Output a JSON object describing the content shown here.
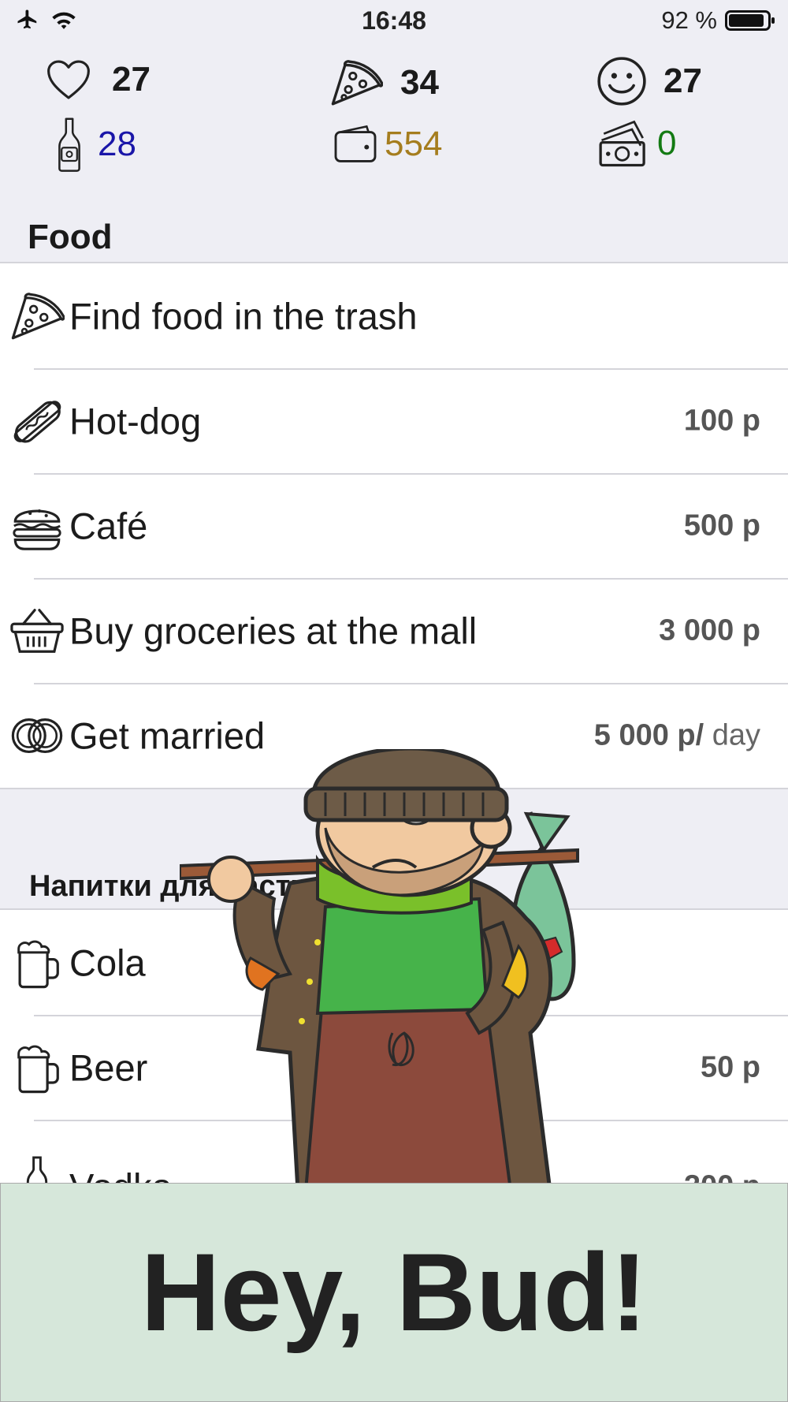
{
  "status_bar": {
    "time": "16:48",
    "battery": "92 %",
    "battery_level": 0.92
  },
  "stats": {
    "health": {
      "icon": "heart-icon",
      "value": "27",
      "color": "#1a1a1a"
    },
    "food": {
      "icon": "pizza-icon",
      "value": "34",
      "color": "#1a1a1a"
    },
    "mood": {
      "icon": "smiley-icon",
      "value": "27",
      "color": "#1a1a1a"
    },
    "alcohol": {
      "icon": "bottle-icon",
      "value": "28",
      "color": "#1a16a8"
    },
    "money": {
      "icon": "wallet-icon",
      "value": "554",
      "color": "#a57d1e"
    },
    "dollars": {
      "icon": "cash-icon",
      "value": "0",
      "color": "#137a13"
    }
  },
  "food_section": {
    "title": "Food",
    "items": [
      {
        "icon": "pizza-slice-icon",
        "label": "Find food in the trash",
        "price": "",
        "per": ""
      },
      {
        "icon": "hotdog-icon",
        "label": "Hot-dog",
        "price": "100 р",
        "per": ""
      },
      {
        "icon": "burger-icon",
        "label": "Café",
        "price": "500 р",
        "per": ""
      },
      {
        "icon": "basket-icon",
        "label": "Buy groceries at the mall",
        "price": "3 000 р",
        "per": ""
      },
      {
        "icon": "rings-icon",
        "label": "Get married",
        "price": "5 000 р/",
        "per": " day"
      }
    ]
  },
  "drinks_section": {
    "title": "Напитки для настро",
    "items": [
      {
        "icon": "beer-mug-icon",
        "label": "Cola",
        "price": ""
      },
      {
        "icon": "beer-mug-icon",
        "label": "Beer",
        "price": "50 р"
      },
      {
        "icon": "bottle-icon",
        "label": "Vodka",
        "price": "200 р"
      }
    ]
  },
  "banner": {
    "text": "Hey, Bud!",
    "background": "#d6e7da"
  }
}
